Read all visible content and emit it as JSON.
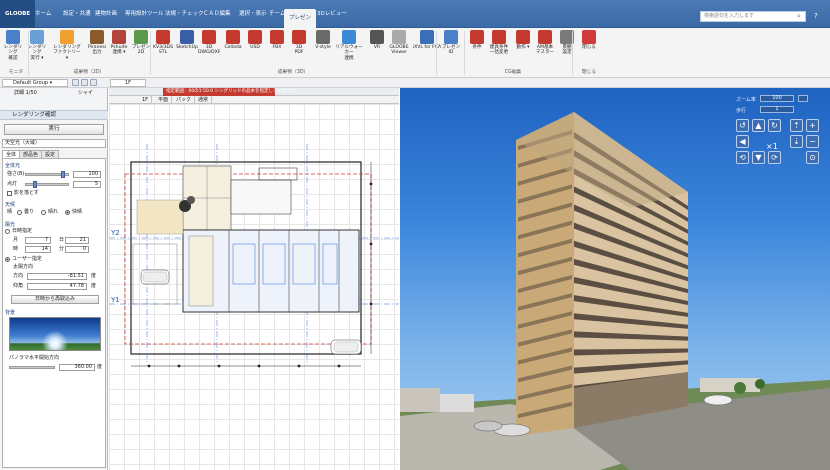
{
  "app": {
    "logo": "GLOOBE",
    "tabs": [
      "ホーム",
      "設定・共通",
      "建物計画",
      "専用設計ツール",
      "法規・チェック",
      "ＣＡＤ編集",
      "選択・表示",
      "チーム",
      "プレゼン",
      "3Dレビュー"
    ],
    "active_tab": "プレゼン",
    "search_placeholder": "検索語句を入力します",
    "search_icon": "search-icon",
    "help_icon": "help-icon"
  },
  "ribbon": {
    "buttons": [
      {
        "label": "レンダリング\n確認",
        "icon": "render-check-icon",
        "color": "#4a7fc9"
      },
      {
        "label": "レンダリング\n実行 ▾",
        "icon": "render-run-icon",
        "color": "#6a9fd6"
      },
      {
        "label": "レンダリング\nファクトリー ▾",
        "icon": "render-factory-icon",
        "color": "#f0a030"
      },
      {
        "label": "Piranesi\n出力",
        "icon": "piranesi-icon",
        "color": "#8a5a2a"
      },
      {
        "label": "Pshuite\n連携 ▾",
        "icon": "pshuite-icon",
        "color": "#b4423a"
      },
      {
        "label": "プレゼン\n2D",
        "icon": "present-2d-icon",
        "color": "#5a9a4a"
      },
      {
        "label": "KV3/3DS\nSTL",
        "icon": "kv3-icon",
        "color": "#c43a2f"
      },
      {
        "label": "SketchUp",
        "icon": "sketchup-icon",
        "color": "#3a5fa8"
      },
      {
        "label": "3D\nDWG/DXF",
        "icon": "dwg-icon",
        "color": "#c43a2f"
      },
      {
        "label": "Collada",
        "icon": "collada-icon",
        "color": "#c43a2f"
      },
      {
        "label": "USD",
        "icon": "usd-icon",
        "color": "#c43a2f"
      },
      {
        "label": "FBX",
        "icon": "fbx-icon",
        "color": "#c43a2f"
      },
      {
        "label": "3D\nPDF",
        "icon": "pdf3d-icon",
        "color": "#c43a2f"
      },
      {
        "label": "V-style",
        "icon": "vstyle-icon",
        "color": "#6a6a6a"
      },
      {
        "label": "リアルウォーカー\n連携",
        "icon": "realwalker-icon",
        "color": "#3a8ad6"
      },
      {
        "label": "VR",
        "icon": "vr-icon",
        "color": "#555555"
      },
      {
        "label": "GLOOBE\nViewer",
        "icon": "gloobe-viewer-icon",
        "color": "#aaaaaa"
      },
      {
        "label": "iXVL for FCA",
        "icon": "ixvl-icon",
        "color": "#3a6fb6"
      },
      {
        "label": "プレゼンID",
        "icon": "present-id-icon",
        "color": "#4a7fc9"
      },
      {
        "label": "条件",
        "icon": "conditions-icon",
        "color": "#c43a2f"
      },
      {
        "label": "建具条件\n一括変更",
        "icon": "fitting-change-icon",
        "color": "#c43a2f"
      },
      {
        "label": "動作 ▾",
        "icon": "action-icon",
        "color": "#c43a2f"
      },
      {
        "label": "AM基本\nマスター",
        "icon": "am-master-icon",
        "color": "#c43a2f"
      },
      {
        "label": "景観\n設定",
        "icon": "landscape-icon",
        "color": "#7a7a7a"
      },
      {
        "label": "閉じる",
        "icon": "close-icon",
        "color": "#d03a3a"
      }
    ],
    "groups": [
      "モニタ",
      "成果物（2D）",
      "成果物（3D）",
      "CG編集",
      "閉じる"
    ]
  },
  "toolbar2": {
    "group_select": "Default Group ▾",
    "floor": "1F"
  },
  "left_panel": {
    "scale": "詳細 1/50",
    "view_label": "シャイ",
    "title": "レンダリング確認",
    "execute": "実行",
    "preset": "天空光（大域）",
    "tabs": [
      "全体",
      "部品色",
      "設定"
    ],
    "section_ambient": "全体光",
    "brightness_label": "強さ(B)",
    "brightness_value": "100",
    "point_label": "点灯",
    "point_value": "5",
    "shadow_label": "影を落とす",
    "section_sky": "天候",
    "sky_options": [
      "晴",
      "曇り",
      "晴れ",
      "快晴"
    ],
    "section_sun": "陽光",
    "sun_mode_1": "日時指定",
    "month_label": "月",
    "month_value": "7",
    "day_label": "日",
    "day_value": "21",
    "hour_label": "時",
    "hour_value": "14",
    "minute_label": "分",
    "minute_value": "0",
    "sun_mode_2": "ユーザー指定",
    "sun_sub": "太陽方向",
    "azimuth_label": "方向",
    "azimuth_value": "-81.51",
    "unit_deg": "度",
    "altitude_label": "仰角",
    "altitude_value": "47.78",
    "sun_button": "日時から再取込み",
    "section_bg": "背景",
    "pan_label": "パノラマ水平開始方向",
    "pan_value": "360.00"
  },
  "plan": {
    "header_red": "指定範囲：00の1:50.0  シングリッドの品本を指定してください。",
    "header_floor": "1F",
    "tabs": [
      "1F",
      "平面",
      "パック",
      "通常"
    ],
    "axis_y2": "Y2",
    "axis_y1": "Y1"
  },
  "view3d": {
    "zoom_label": "ズーム率",
    "zoom_value": "100",
    "speed_label": "歩行",
    "speed_value": "1",
    "multiplier": "×1"
  }
}
